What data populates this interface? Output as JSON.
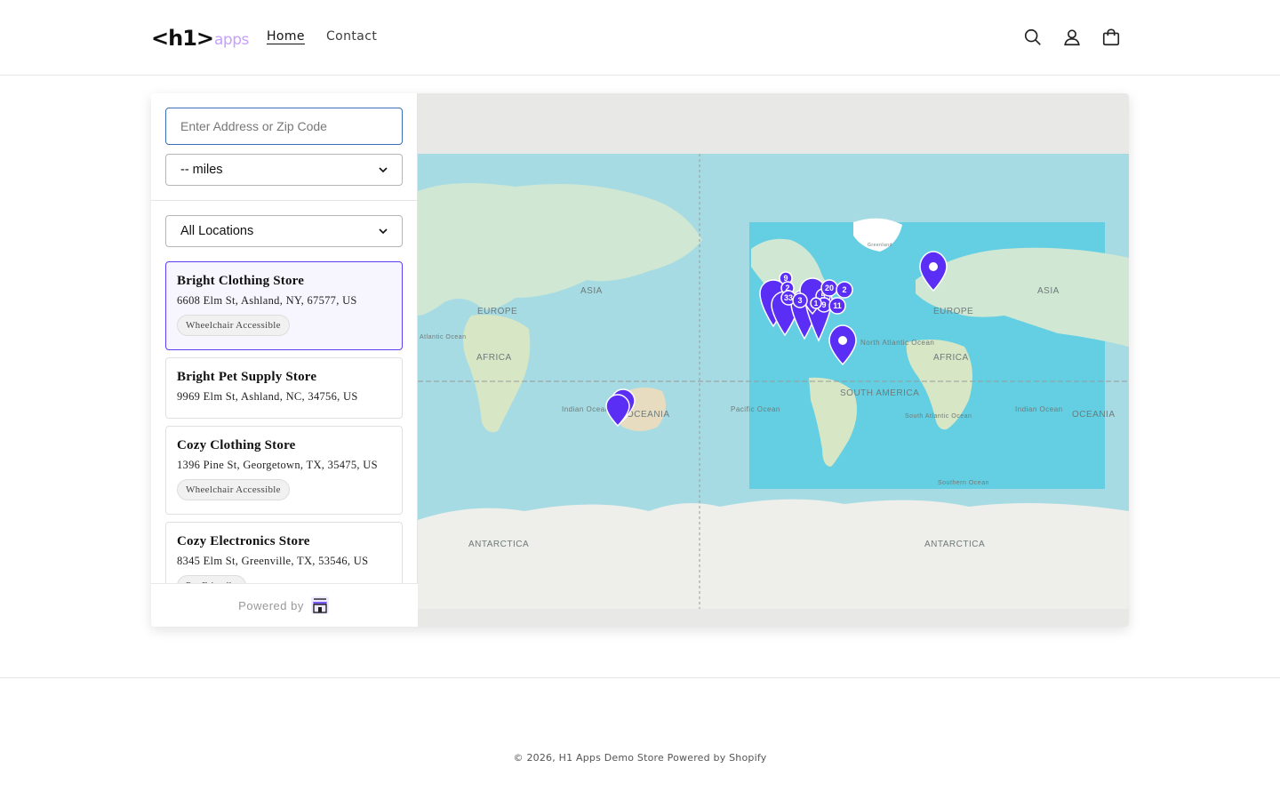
{
  "header": {
    "logo_main": "<h1>",
    "logo_sub": "apps",
    "nav": [
      {
        "label": "Home",
        "active": true
      },
      {
        "label": "Contact",
        "active": false
      }
    ],
    "icons": [
      "search-icon",
      "account-icon",
      "cart-icon"
    ]
  },
  "locator": {
    "address_placeholder": "Enter Address or Zip Code",
    "address_value": "",
    "radius_selected": "-- miles",
    "location_filter_selected": "All Locations",
    "stores": [
      {
        "name": "Bright Clothing Store",
        "address": "6608 Elm St, Ashland, NY, 67577, US",
        "tag": "Wheelchair Accessible",
        "selected": true
      },
      {
        "name": "Bright Pet Supply Store",
        "address": "9969 Elm St, Ashland, NC, 34756, US",
        "tag": "",
        "selected": false
      },
      {
        "name": "Cozy Clothing Store",
        "address": "1396 Pine St, Georgetown, TX, 35475, US",
        "tag": "Wheelchair Accessible",
        "selected": false
      },
      {
        "name": "Cozy Electronics Store",
        "address": "8345 Elm St, Greenville, TX, 53546, US",
        "tag": "Pet Friendly",
        "selected": false
      }
    ],
    "powered_by": "Powered by"
  },
  "map": {
    "labels": {
      "asia_left": "ASIA",
      "europe_left": "EUROPE",
      "africa_left": "AFRICA",
      "indian_ocean_left": "Indian Ocean",
      "oceania_left": "OCEANIA",
      "pacific_ocean": "Pacific Ocean",
      "south_america": "SOUTH AMERICA",
      "north_atlantic": "North Atlantic Ocean",
      "europe_right": "EUROPE",
      "asia_right": "ASIA",
      "africa_right": "AFRICA",
      "indian_ocean_right": "Indian Ocean",
      "oceania_right": "OCEANIA",
      "south_atlantic": "South Atlantic Ocean",
      "southern_ocean": "Southern Ocean",
      "antarctica_left": "ANTARCTICA",
      "antarctica_right": "ANTARCTICA",
      "greenland": "Greenland",
      "atlantic_partial": "Atlantic Ocean"
    },
    "cluster_counts": [
      "9",
      "2",
      "33",
      "3",
      "5",
      "20",
      "2",
      "9",
      "11",
      "1"
    ],
    "marker_color": "#5b2ef5",
    "highlight_color": "#4ecbe2"
  },
  "footer": {
    "text": "© 2026, H1 Apps Demo Store Powered by Shopify"
  }
}
